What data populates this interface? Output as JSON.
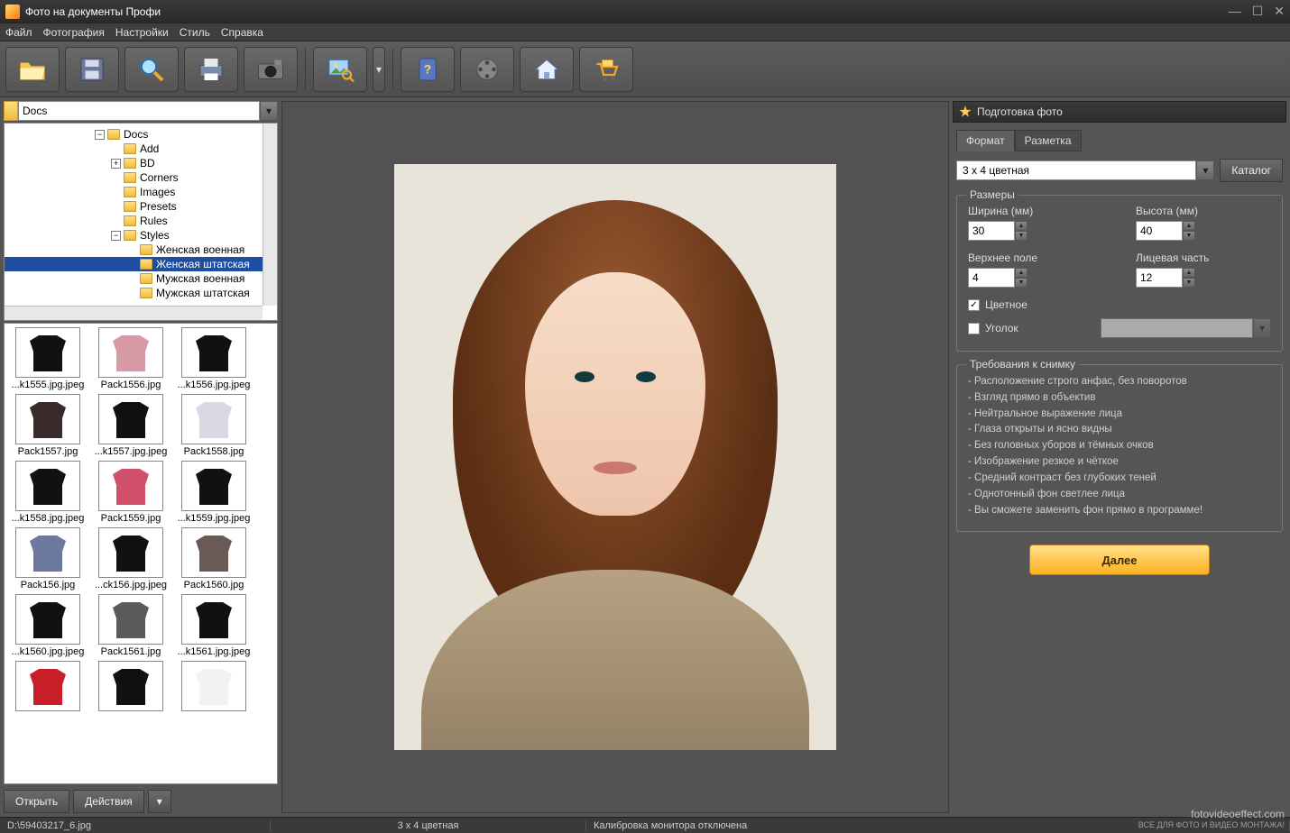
{
  "window": {
    "title": "Фото на документы Профи"
  },
  "menu": {
    "items": [
      "Файл",
      "Фотография",
      "Настройки",
      "Стиль",
      "Справка"
    ]
  },
  "toolbar": {
    "icons": [
      "folder-open-icon",
      "save-icon",
      "zoom-icon",
      "print-icon",
      "camera-icon",
      "image-detect-icon",
      "help-book-icon",
      "video-reel-icon",
      "home-icon",
      "cart-icon"
    ]
  },
  "path": {
    "value": "Docs"
  },
  "tree": [
    {
      "depth": 0,
      "exp": "-",
      "label": "Docs"
    },
    {
      "depth": 1,
      "exp": "",
      "label": "Add"
    },
    {
      "depth": 1,
      "exp": "+",
      "label": "BD"
    },
    {
      "depth": 1,
      "exp": "",
      "label": "Corners"
    },
    {
      "depth": 1,
      "exp": "",
      "label": "Images"
    },
    {
      "depth": 1,
      "exp": "",
      "label": "Presets"
    },
    {
      "depth": 1,
      "exp": "",
      "label": "Rules"
    },
    {
      "depth": 1,
      "exp": "-",
      "label": "Styles"
    },
    {
      "depth": 2,
      "exp": "",
      "label": "Женская военная"
    },
    {
      "depth": 2,
      "exp": "",
      "label": "Женская штатская",
      "selected": true
    },
    {
      "depth": 2,
      "exp": "",
      "label": "Мужская военная"
    },
    {
      "depth": 2,
      "exp": "",
      "label": "Мужская штатская"
    }
  ],
  "thumbs": [
    {
      "label": "...k1555.jpg.jpeg",
      "c": "#111"
    },
    {
      "label": "Pack1556.jpg",
      "c": "#d89aa5"
    },
    {
      "label": "...k1556.jpg.jpeg",
      "c": "#111"
    },
    {
      "label": "Pack1557.jpg",
      "c": "#3a2a2a"
    },
    {
      "label": "...k1557.jpg.jpeg",
      "c": "#111"
    },
    {
      "label": "Pack1558.jpg",
      "c": "#d8d8e4"
    },
    {
      "label": "...k1558.jpg.jpeg",
      "c": "#111"
    },
    {
      "label": "Pack1559.jpg",
      "c": "#d0506a"
    },
    {
      "label": "...k1559.jpg.jpeg",
      "c": "#111"
    },
    {
      "label": "Pack156.jpg",
      "c": "#6b7a9c"
    },
    {
      "label": "...ck156.jpg.jpeg",
      "c": "#111"
    },
    {
      "label": "Pack1560.jpg",
      "c": "#6a5a55"
    },
    {
      "label": "...k1560.jpg.jpeg",
      "c": "#111"
    },
    {
      "label": "Pack1561.jpg",
      "c": "#5a5a5a"
    },
    {
      "label": "...k1561.jpg.jpeg",
      "c": "#111"
    },
    {
      "label": "",
      "c": "#c91d2a"
    },
    {
      "label": "",
      "c": "#111"
    },
    {
      "label": "",
      "c": "#f2f2f2"
    }
  ],
  "actions": {
    "open": "Открыть",
    "actions": "Действия"
  },
  "right": {
    "header": "Подготовка фото",
    "tabs": {
      "a": "Формат",
      "b": "Разметка"
    },
    "format_value": "3 x 4 цветная",
    "catalog": "Каталог",
    "sizes": {
      "legend": "Размеры",
      "width_lab": "Ширина (мм)",
      "width": "30",
      "height_lab": "Высота (мм)",
      "height": "40",
      "top_lab": "Верхнее поле",
      "top": "4",
      "face_lab": "Лицевая часть",
      "face": "12",
      "color": "Цветное",
      "corner": "Уголок"
    },
    "req": {
      "legend": "Требования к снимку",
      "items": [
        "Расположение строго анфас, без поворотов",
        "Взгляд прямо в объектив",
        "Нейтральное выражение лица",
        "Глаза открыты и ясно видны",
        "Без головных уборов и тёмных очков",
        "Изображение резкое и чёткое",
        "Средний контраст без глубоких теней",
        "Однотонный фон светлее лица",
        "Вы сможете заменить фон прямо в программе!"
      ]
    },
    "next": "Далее"
  },
  "status": {
    "path": "D:\\59403217_6.jpg",
    "format": "3 x 4 цветная",
    "calib": "Калибровка монитора отключена"
  },
  "watermark": {
    "a": "fotovideoeffect.com",
    "b": "ВСЕ ДЛЯ ФОТО И ВИДЕО МОНТАЖА!"
  }
}
